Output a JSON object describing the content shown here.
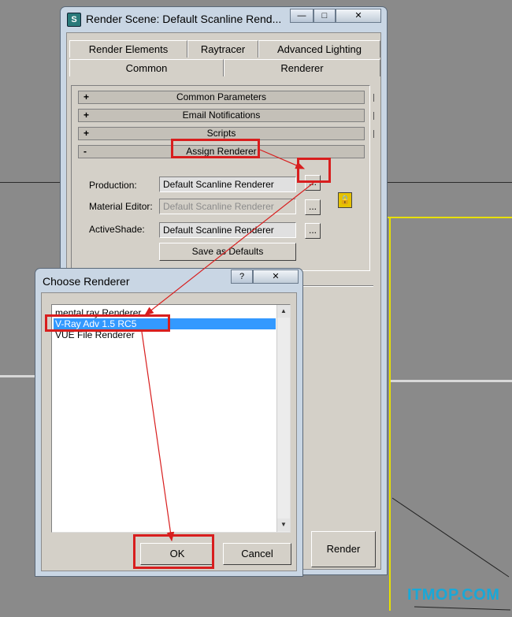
{
  "render_window": {
    "title": "Render Scene: Default Scanline Rend...",
    "window_controls": {
      "minimize": "—",
      "maximize": "□",
      "close": "✕"
    },
    "tabs_row1": [
      "Render Elements",
      "Raytracer",
      "Advanced Lighting"
    ],
    "tabs_row2": [
      "Common",
      "Renderer"
    ],
    "rollouts": [
      {
        "sign": "+",
        "label": "Common Parameters"
      },
      {
        "sign": "+",
        "label": "Email Notifications"
      },
      {
        "sign": "+",
        "label": "Scripts"
      },
      {
        "sign": "-",
        "label": "Assign Renderer"
      }
    ],
    "assign": {
      "production_label": "Production:",
      "production_value": "Default Scanline Renderer",
      "material_label": "Material Editor:",
      "material_value": "Default Scanline Renderer",
      "activeshade_label": "ActiveShade:",
      "activeshade_value": "Default Scanline Renderer",
      "browse_label": "...",
      "save_defaults_label": "Save as Defaults"
    },
    "render_button": "Render"
  },
  "choose_dialog": {
    "title": "Choose Renderer",
    "help_label": "?",
    "close_label": "✕",
    "items": [
      "mental ray Renderer",
      "V-Ray Adv 1.5 RC5",
      "VUE File Renderer"
    ],
    "selected_index": 1,
    "ok_label": "OK",
    "cancel_label": "Cancel"
  },
  "watermark": "ITMOP.COM",
  "colors": {
    "highlight": "#d81e1e",
    "selection": "#3399ff"
  }
}
